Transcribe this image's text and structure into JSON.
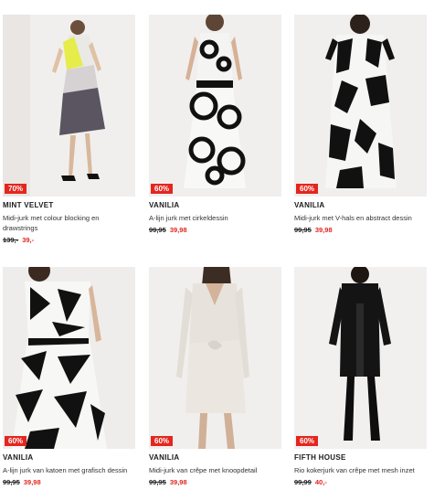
{
  "products": [
    {
      "brand": "MINT VELVET",
      "description": "Midi-jurk met colour blocking en drawstrings",
      "old_price": "139,-",
      "new_price": "39,-",
      "discount": "70%"
    },
    {
      "brand": "VANILIA",
      "description": "A-lijn jurk met cirkeldessin",
      "old_price": "99,95",
      "new_price": "39,98",
      "discount": "60%"
    },
    {
      "brand": "VANILIA",
      "description": "Midi-jurk met V-hals en abstract dessin",
      "old_price": "99,95",
      "new_price": "39,98",
      "discount": "60%"
    },
    {
      "brand": "VANILIA",
      "description": "A-lijn jurk van katoen met grafisch dessin",
      "old_price": "99,95",
      "new_price": "39,98",
      "discount": "60%"
    },
    {
      "brand": "VANILIA",
      "description": "Midi-jurk van crêpe met knoopdetail",
      "old_price": "99,95",
      "new_price": "39,98",
      "discount": "60%"
    },
    {
      "brand": "FIFTH HOUSE",
      "description": "Rio kokerjurk van crêpe met mesh inzet",
      "old_price": "99,99",
      "new_price": "40,-",
      "discount": "60%"
    }
  ],
  "colors": {
    "sale_red": "#e3261f",
    "background": "#ffffff"
  }
}
